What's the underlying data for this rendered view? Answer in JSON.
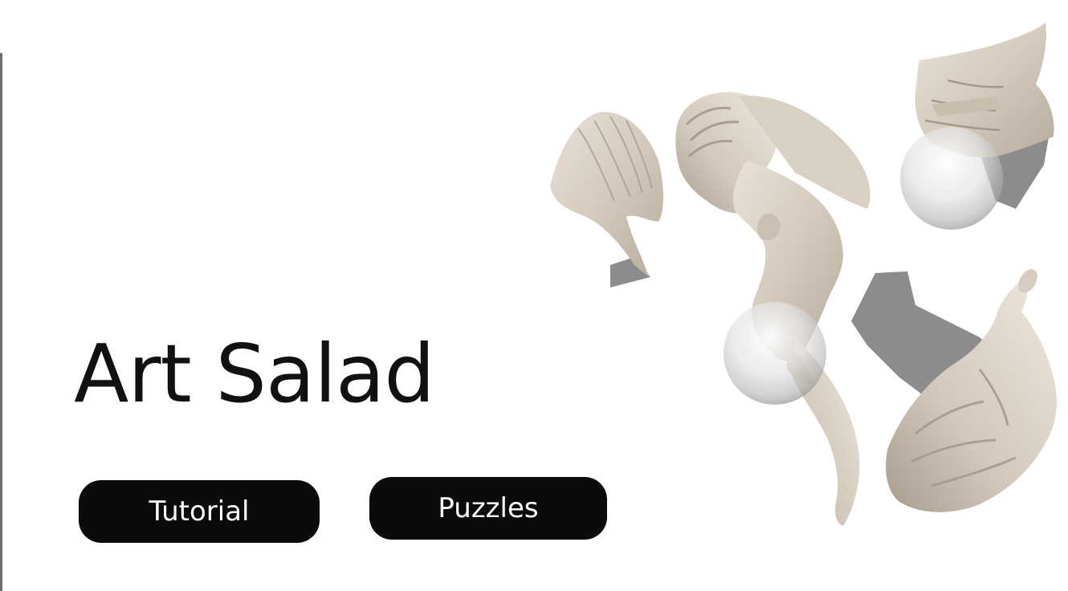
{
  "app": {
    "title": "Art Salad"
  },
  "menu": {
    "tutorial_label": "Tutorial",
    "puzzles_label": "Puzzles"
  },
  "colors": {
    "background": "#ffffff",
    "button_fill": "#0b0b0b",
    "button_text": "#ffffff",
    "title_text": "#111111",
    "stone": "#d8cfc4",
    "stone_shadow": "#a89d90",
    "missing_piece_gray": "#8c8c8c"
  },
  "scene": {
    "subject": "marble-angel-statue-puzzle",
    "icons": [
      "wing-fragment-icon",
      "angel-torso-fragment-icon",
      "drapery-fragment-icon",
      "base-fragment-icon",
      "glass-sphere-icon"
    ]
  }
}
